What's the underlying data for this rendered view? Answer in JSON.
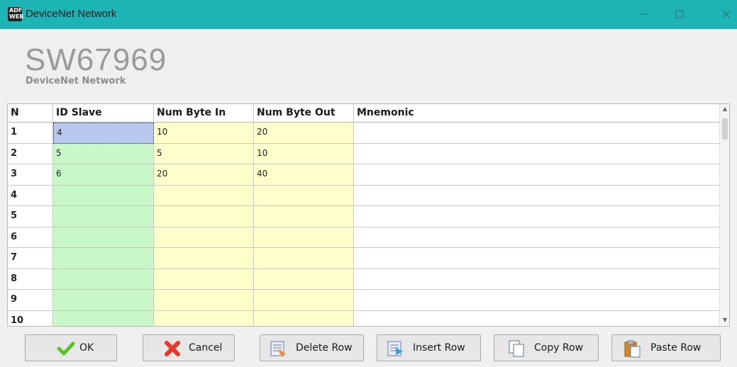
{
  "window": {
    "icon_text_top": "ADF",
    "icon_text_bottom": "WEB",
    "title": "DeviceNet Network"
  },
  "header": {
    "code": "SW67969",
    "subtitle": "DeviceNet Network"
  },
  "table": {
    "columns": [
      "N",
      "ID Slave",
      "Num Byte In",
      "Num Byte Out",
      "Mnemonic"
    ],
    "rows": [
      {
        "n": "1",
        "id": "4",
        "in": "10",
        "out": "20",
        "mn": ""
      },
      {
        "n": "2",
        "id": "5",
        "in": "5",
        "out": "10",
        "mn": ""
      },
      {
        "n": "3",
        "id": "6",
        "in": "20",
        "out": "40",
        "mn": ""
      },
      {
        "n": "4",
        "id": "",
        "in": "",
        "out": "",
        "mn": ""
      },
      {
        "n": "5",
        "id": "",
        "in": "",
        "out": "",
        "mn": ""
      },
      {
        "n": "6",
        "id": "",
        "in": "",
        "out": "",
        "mn": ""
      },
      {
        "n": "7",
        "id": "",
        "in": "",
        "out": "",
        "mn": ""
      },
      {
        "n": "8",
        "id": "",
        "in": "",
        "out": "",
        "mn": ""
      },
      {
        "n": "9",
        "id": "",
        "in": "",
        "out": "",
        "mn": ""
      },
      {
        "n": "10",
        "id": "",
        "in": "",
        "out": "",
        "mn": ""
      }
    ]
  },
  "buttons": {
    "ok": {
      "label": "OK",
      "icon": "checkmark-icon"
    },
    "cancel": {
      "label": "Cancel",
      "icon": "cancel-x-icon"
    },
    "delete_row": {
      "label": "Delete Row",
      "icon": "delete-row-icon"
    },
    "insert_row": {
      "label": "Insert Row",
      "icon": "insert-row-icon"
    },
    "copy_row": {
      "label": "Copy Row",
      "icon": "copy-icon"
    },
    "paste_row": {
      "label": "Paste Row",
      "icon": "paste-icon"
    }
  },
  "colors": {
    "titlebar": "#1cb4b4",
    "id_column": "#c8f7c8",
    "byte_columns": "#ffffcc",
    "selected_cell": "#b8c8ee"
  }
}
